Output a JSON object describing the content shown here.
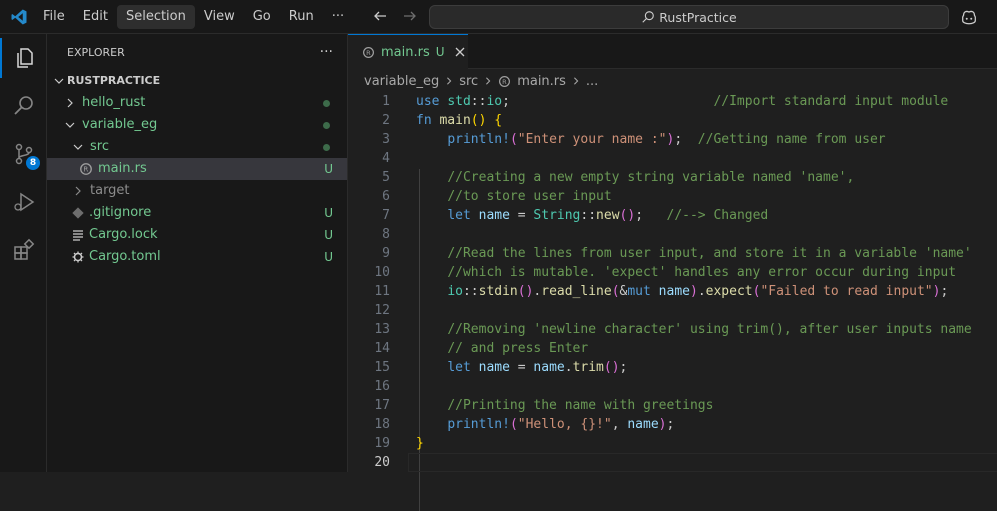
{
  "titlebar": {
    "menu": [
      "File",
      "Edit",
      "Selection",
      "View",
      "Go",
      "Run",
      "···"
    ],
    "active_menu": "Selection",
    "search_text": "RustPractice"
  },
  "activity": {
    "source_control_badge": "8"
  },
  "explorer": {
    "title": "EXPLORER",
    "more": "···",
    "root": "RUSTPRACTICE",
    "items": [
      {
        "label": "hello_rust",
        "status": "dot"
      },
      {
        "label": "variable_eg",
        "status": "dot"
      },
      {
        "label": "src",
        "status": "dot"
      },
      {
        "label": "main.rs",
        "status": "U"
      },
      {
        "label": "target",
        "status": ""
      },
      {
        "label": ".gitignore",
        "status": "U"
      },
      {
        "label": "Cargo.lock",
        "status": "U"
      },
      {
        "label": "Cargo.toml",
        "status": "U"
      }
    ]
  },
  "editor": {
    "tab": {
      "name": "main.rs",
      "status": "U"
    },
    "breadcrumb": [
      "variable_eg",
      "src",
      "main.rs",
      "..."
    ],
    "line_numbers": [
      "1",
      "2",
      "3",
      "4",
      "5",
      "6",
      "7",
      "8",
      "9",
      "10",
      "11",
      "12",
      "13",
      "14",
      "15",
      "16",
      "17",
      "18",
      "19",
      "20"
    ],
    "colors": {
      "keyword": "#569cd6",
      "function": "#dcdcaa",
      "string": "#ce9178",
      "comment": "#6a9955",
      "type": "#4ec9b0",
      "variable": "#9cdcfe"
    },
    "lines": [
      [
        [
          "kw",
          "use "
        ],
        [
          "ty",
          "std"
        ],
        [
          "pu",
          "::"
        ],
        [
          "ty",
          "io"
        ],
        [
          "pu",
          ";                          "
        ],
        [
          "cm",
          "//Import standard input module"
        ]
      ],
      [
        [
          "kw",
          "fn "
        ],
        [
          "fn",
          "main"
        ],
        [
          "br1",
          "() {"
        ]
      ],
      [
        [
          "pu",
          "    "
        ],
        [
          "mac",
          "println!"
        ],
        [
          "br2",
          "("
        ],
        [
          "str",
          "\"Enter your name :\""
        ],
        [
          "br2",
          ")"
        ],
        [
          "pu",
          ";  "
        ],
        [
          "cm",
          "//Getting name from user"
        ]
      ],
      [],
      [
        [
          "pu",
          "    "
        ],
        [
          "cm",
          "//Creating a new empty string variable named 'name',"
        ]
      ],
      [
        [
          "pu",
          "    "
        ],
        [
          "cm",
          "//to store user input"
        ]
      ],
      [
        [
          "pu",
          "    "
        ],
        [
          "kw",
          "let "
        ],
        [
          "va",
          "name"
        ],
        [
          "pu",
          " = "
        ],
        [
          "ty",
          "String"
        ],
        [
          "pu",
          "::"
        ],
        [
          "fn",
          "new"
        ],
        [
          "br2",
          "()"
        ],
        [
          "pu",
          ";   "
        ],
        [
          "cm",
          "//--> Changed"
        ]
      ],
      [],
      [
        [
          "pu",
          "    "
        ],
        [
          "cm",
          "//Read the lines from user input, and store it in a variable 'name'"
        ]
      ],
      [
        [
          "pu",
          "    "
        ],
        [
          "cm",
          "//which is mutable. 'expect' handles any error occur during input"
        ]
      ],
      [
        [
          "pu",
          "    "
        ],
        [
          "ty",
          "io"
        ],
        [
          "pu",
          "::"
        ],
        [
          "fn",
          "stdin"
        ],
        [
          "br2",
          "()"
        ],
        [
          "pu",
          "."
        ],
        [
          "fn",
          "read_line"
        ],
        [
          "br2",
          "("
        ],
        [
          "pu",
          "&"
        ],
        [
          "kw",
          "mut "
        ],
        [
          "va",
          "name"
        ],
        [
          "br2",
          ")"
        ],
        [
          "pu",
          "."
        ],
        [
          "fn",
          "expect"
        ],
        [
          "br2",
          "("
        ],
        [
          "str",
          "\"Failed to read input\""
        ],
        [
          "br2",
          ")"
        ],
        [
          "pu",
          ";"
        ]
      ],
      [],
      [
        [
          "pu",
          "    "
        ],
        [
          "cm",
          "//Removing 'newline character' using trim(), after user inputs name"
        ]
      ],
      [
        [
          "pu",
          "    "
        ],
        [
          "cm",
          "// and press Enter"
        ]
      ],
      [
        [
          "pu",
          "    "
        ],
        [
          "kw",
          "let "
        ],
        [
          "va",
          "name"
        ],
        [
          "pu",
          " = "
        ],
        [
          "va",
          "name"
        ],
        [
          "pu",
          "."
        ],
        [
          "fn",
          "trim"
        ],
        [
          "br2",
          "()"
        ],
        [
          "pu",
          ";"
        ]
      ],
      [],
      [
        [
          "pu",
          "    "
        ],
        [
          "cm",
          "//Printing the name with greetings"
        ]
      ],
      [
        [
          "pu",
          "    "
        ],
        [
          "mac",
          "println!"
        ],
        [
          "br2",
          "("
        ],
        [
          "str",
          "\"Hello, {}!\""
        ],
        [
          "pu",
          ", "
        ],
        [
          "va",
          "name"
        ],
        [
          "br2",
          ")"
        ],
        [
          "pu",
          ";"
        ]
      ],
      [
        [
          "br1",
          "}"
        ]
      ],
      []
    ]
  }
}
